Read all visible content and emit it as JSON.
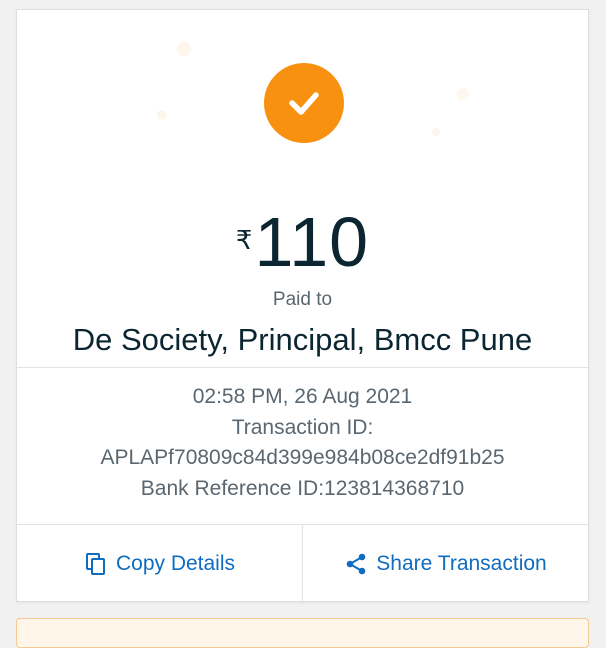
{
  "receipt": {
    "currency_symbol": "₹",
    "amount": "110",
    "paid_to_label": "Paid to",
    "payee_name": "De Society, Principal, Bmcc Pune",
    "datetime": "02:58 PM, 26 Aug 2021",
    "transaction_id_label": "Transaction ID:",
    "transaction_id": "APLAPf70809c84d399e984b08ce2df91b25",
    "bank_reference": "Bank Reference ID:123814368710"
  },
  "actions": {
    "copy_label": "Copy Details",
    "share_label": "Share Transaction"
  },
  "icons": {
    "status": "check-icon",
    "copy": "copy-icon",
    "share": "share-icon"
  },
  "colors": {
    "status_accent": "#f7910f",
    "link": "#0f6cc0",
    "text_dark": "#0b2630",
    "text_muted": "#5b6770"
  }
}
